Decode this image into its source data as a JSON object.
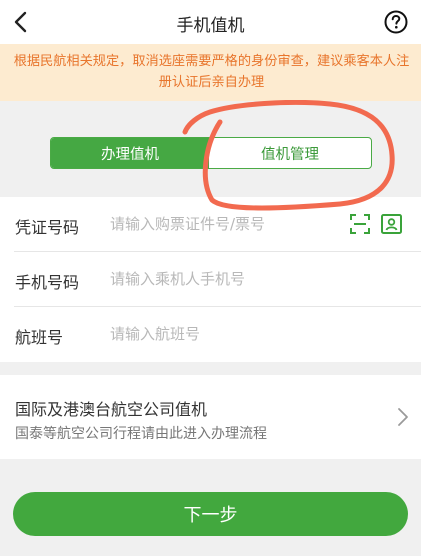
{
  "header": {
    "title": "手机值机",
    "back_icon": "back-arrow-icon",
    "help_icon": "question-circle-icon"
  },
  "notice": {
    "text": "根据民航相关规定，取消选座需要严格的身份审查，建议乘客本人注册认证后亲自办理"
  },
  "tabs": [
    {
      "label": "办理值机",
      "active": true
    },
    {
      "label": "值机管理",
      "active": false
    }
  ],
  "form": {
    "rows": [
      {
        "label": "凭证号码",
        "placeholder": "请输入购票证件号/票号",
        "value": "",
        "icons": [
          "scan-icon",
          "id-card-icon"
        ]
      },
      {
        "label": "手机号码",
        "placeholder": "请输入乘机人手机号",
        "value": ""
      },
      {
        "label": "航班号",
        "placeholder": "请输入航班号",
        "value": ""
      }
    ]
  },
  "international": {
    "title": "国际及港澳台航空公司值机",
    "subtitle": "国泰等航空公司行程请由此进入办理流程",
    "icon": "chevron-right-icon"
  },
  "next_button": {
    "label": "下一步"
  },
  "colors": {
    "brand_green": "#45a843",
    "notice_bg": "#fdebd0",
    "notice_text": "#e8752c",
    "annotation": "#f26a4f"
  }
}
